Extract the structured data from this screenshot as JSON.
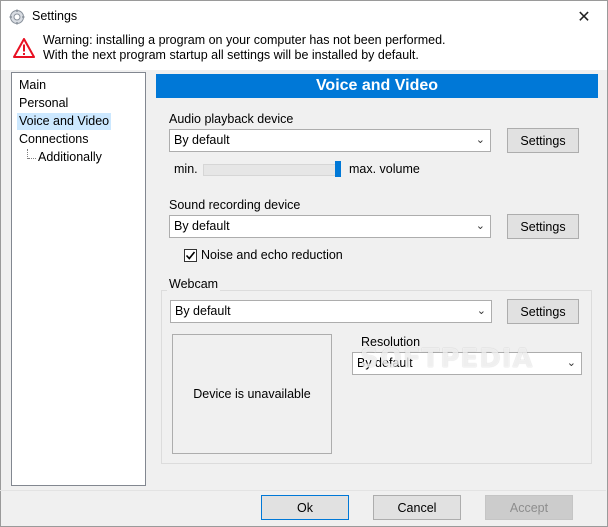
{
  "window": {
    "title": "Settings",
    "close_glyph": "✕"
  },
  "warning": {
    "line1": "Warning: installing a program on your computer has not been performed.",
    "line2": "With the next program startup all settings will be installed by default."
  },
  "nav": {
    "items": [
      "Main",
      "Personal",
      "Voice and Video",
      "Connections",
      "Additionally"
    ],
    "selected": "Voice and Video"
  },
  "panel": {
    "title": "Voice and Video",
    "audio_playback": {
      "label": "Audio playback device",
      "value": "By default",
      "settings_label": "Settings",
      "volume_min_label": "min.",
      "volume_max_label": "max. volume",
      "volume_level": 1.0
    },
    "sound_recording": {
      "label": "Sound recording device",
      "value": "By default",
      "settings_label": "Settings"
    },
    "noise_reduction": {
      "label": "Noise and echo reduction",
      "checked": true
    },
    "webcam": {
      "label": "Webcam",
      "value": "By default",
      "settings_label": "Settings",
      "preview_text": "Device is unavailable",
      "resolution_label": "Resolution",
      "resolution_value": "By default"
    }
  },
  "footer": {
    "ok": "Ok",
    "cancel": "Cancel",
    "accept": "Accept"
  },
  "watermark": "SOFTPEDIA",
  "colors": {
    "accent": "#0078d7",
    "selection": "#cce8ff",
    "warning_red": "#e81123"
  }
}
